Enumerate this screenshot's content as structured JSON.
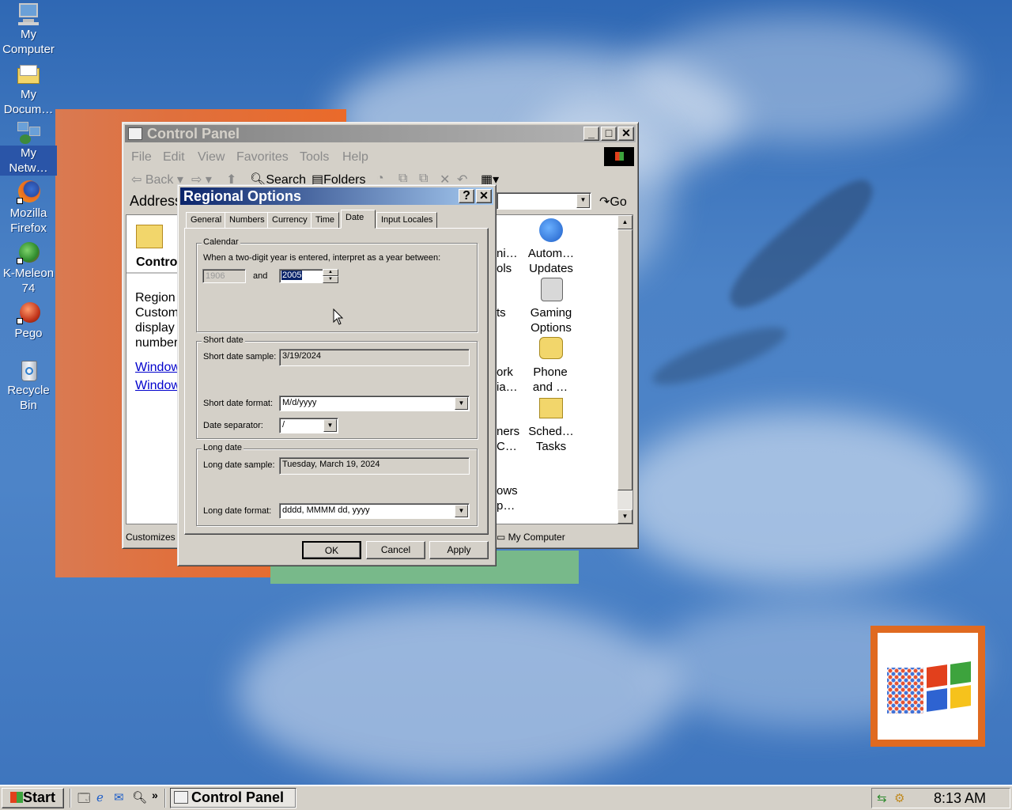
{
  "desktop": {
    "icons": [
      {
        "name": "my-computer",
        "label_lines": [
          "My",
          "Computer"
        ]
      },
      {
        "name": "my-documents",
        "label_lines": [
          "My",
          "Docum…"
        ]
      },
      {
        "name": "my-network",
        "label_lines": [
          "My",
          "Netw…"
        ]
      },
      {
        "name": "mozilla-firefox",
        "label_lines": [
          "Mozilla",
          "Firefox"
        ]
      },
      {
        "name": "k-meleon",
        "label_lines": [
          "K-Meleon",
          "74"
        ]
      },
      {
        "name": "pego",
        "label_lines": [
          "Pego"
        ]
      },
      {
        "name": "recycle-bin",
        "label_lines": [
          "Recycle",
          "Bin"
        ]
      }
    ]
  },
  "control_panel": {
    "title": "Control Panel",
    "menu": [
      "File",
      "Edit",
      "View",
      "Favorites",
      "Tools",
      "Help"
    ],
    "toolbar": {
      "back": "Back",
      "search": "Search",
      "folders": "Folders"
    },
    "address_label": "Address",
    "go_label": "Go",
    "left_panel": {
      "header": "Contro",
      "title": "Region",
      "desc_lines": [
        "Custom",
        "display",
        "number"
      ],
      "links": [
        "Window",
        "Window"
      ]
    },
    "icons_partial": [
      {
        "lines": [
          "ni…",
          "ols"
        ]
      },
      {
        "lines": [
          "ts"
        ]
      },
      {
        "lines": [
          "ork",
          "ia…"
        ]
      },
      {
        "lines": [
          "ners",
          "C…"
        ]
      },
      {
        "lines": [
          "ows",
          "p…"
        ]
      }
    ],
    "icons": [
      {
        "lines": [
          "Autom…",
          "Updates"
        ]
      },
      {
        "lines": [
          "Gaming",
          "Options"
        ]
      },
      {
        "lines": [
          "Phone",
          "and …"
        ]
      },
      {
        "lines": [
          "Sched…",
          "Tasks"
        ]
      }
    ],
    "status_left": "Customizes",
    "status_right": "My Computer"
  },
  "dialog": {
    "title": "Regional Options",
    "help_btn": "?",
    "close_btn": "✕",
    "tabs": [
      "General",
      "Numbers",
      "Currency",
      "Time",
      "Date",
      "Input Locales"
    ],
    "active_tab": "Date",
    "calendar": {
      "group_title": "Calendar",
      "instruction": "When a two-digit year is entered, interpret as a year between:",
      "from_year": "1906",
      "and_label": "and",
      "to_year": "2005"
    },
    "short_date": {
      "group_title": "Short date",
      "sample_label": "Short date sample:",
      "sample_value": "3/19/2024",
      "format_label": "Short date format:",
      "format_value": "M/d/yyyy",
      "separator_label": "Date separator:",
      "separator_value": "/"
    },
    "long_date": {
      "group_title": "Long date",
      "sample_label": "Long date sample:",
      "sample_value": "Tuesday, March 19, 2024",
      "format_label": "Long date format:",
      "format_value": "dddd, MMMM dd, yyyy"
    },
    "buttons": {
      "ok": "OK",
      "cancel": "Cancel",
      "apply": "Apply"
    }
  },
  "taskbar": {
    "start_label": "Start",
    "chevron": "»",
    "task_button": "Control Panel",
    "clock": "8:13 AM"
  }
}
